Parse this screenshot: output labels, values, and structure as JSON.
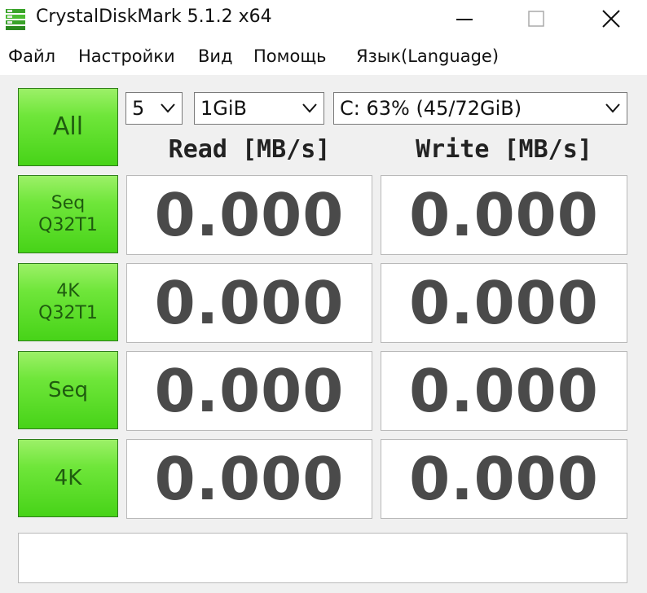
{
  "window": {
    "title": "CrystalDiskMark 5.1.2 x64",
    "icon": "app-icon",
    "controls": [
      "minimize-icon",
      "maximize-icon",
      "close-icon"
    ]
  },
  "menu": [
    {
      "label": "Файл"
    },
    {
      "label": "Настройки"
    },
    {
      "label": "Вид"
    },
    {
      "label": "Помощь"
    },
    {
      "label": "Язык(Language)"
    }
  ],
  "controls": {
    "all_button": "All",
    "count": "5",
    "size": "1GiB",
    "drive": "C: 63% (45/72GiB)"
  },
  "headers": {
    "read": "Read [MB/s]",
    "write": "Write [MB/s]"
  },
  "tests": [
    {
      "label_line1": "Seq",
      "label_line2": "Q32T1",
      "read": "0.000",
      "write": "0.000"
    },
    {
      "label_line1": "4K",
      "label_line2": "Q32T1",
      "read": "0.000",
      "write": "0.000"
    },
    {
      "label_line1": "Seq",
      "label_line2": "",
      "read": "0.000",
      "write": "0.000"
    },
    {
      "label_line1": "4K",
      "label_line2": "",
      "read": "0.000",
      "write": "0.000"
    }
  ],
  "comment": "",
  "colors": {
    "button_green": "#47d318",
    "button_text": "#1f5c0f",
    "value_text": "#4a4a4a",
    "background": "#f0f0f0"
  }
}
